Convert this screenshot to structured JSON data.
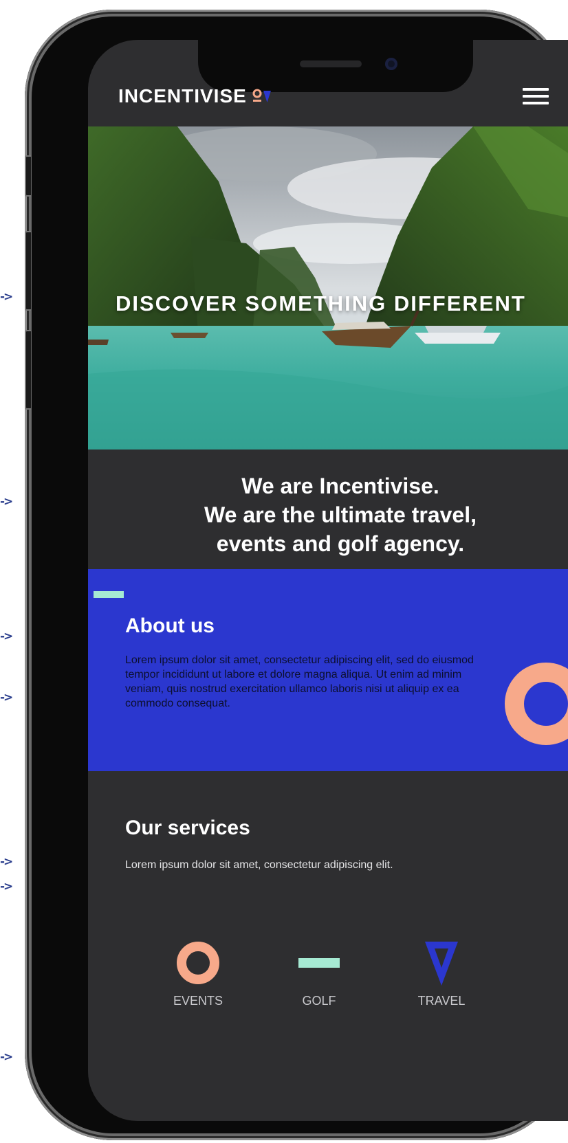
{
  "header": {
    "logo_text": "INCENTIVISE",
    "logo_mark_colors": [
      "#f7a98a",
      "#2b37cf"
    ]
  },
  "hero": {
    "title": "DISCOVER SOMETHING DIFFERENT"
  },
  "intro": {
    "lines": [
      "We are Incentivise.",
      "We are the ultimate travel,",
      "events and golf agency."
    ]
  },
  "about": {
    "title": "About us",
    "text": "Lorem ipsum dolor sit amet, consectetur adipiscing elit, sed do eiusmod tempor incididunt ut labore et dolore magna aliqua. Ut enim ad minim veniam, quis nostrud exercitation ullamco laboris nisi ut aliquip ex ea commodo consequat."
  },
  "services": {
    "title": "Our services",
    "text": "Lorem ipsum dolor sit amet, consectetur adipiscing elit.",
    "items": [
      {
        "label": "EVENTS",
        "icon": "ring-icon"
      },
      {
        "label": "GOLF",
        "icon": "dash-icon"
      },
      {
        "label": "TRAVEL",
        "icon": "triangle-icon"
      }
    ]
  },
  "annotation_arrows": [
    "->",
    "->",
    "->",
    "->",
    "->",
    "->",
    "->"
  ],
  "colors": {
    "background": "#2e2e30",
    "about_bg": "#2b37cf",
    "peach": "#f7a98a",
    "mint": "#a6ead3",
    "blue": "#2b37cf"
  }
}
